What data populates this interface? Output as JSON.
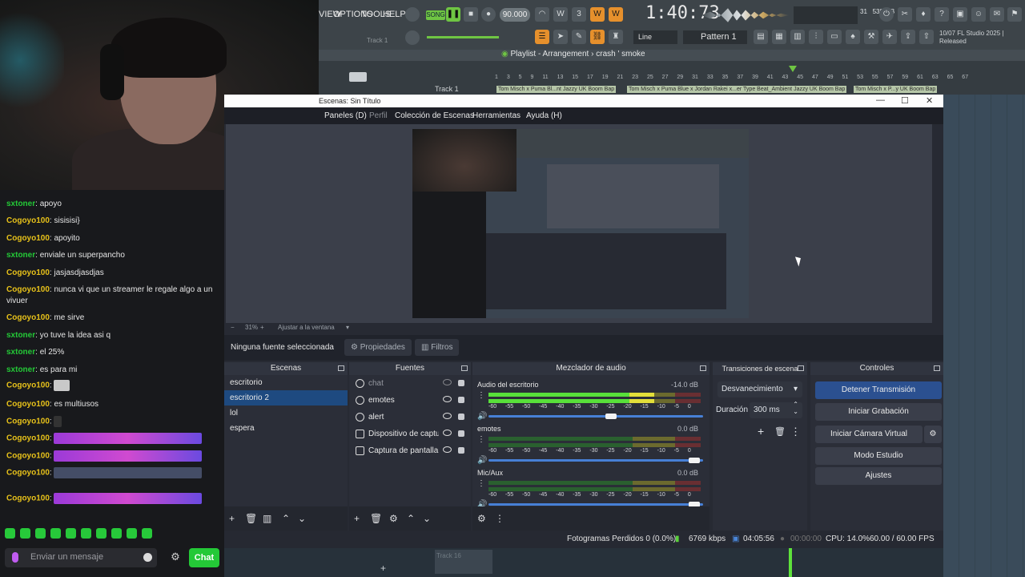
{
  "webcam": {
    "label": "streamer webcam"
  },
  "chat": {
    "messages": [
      {
        "user": "sxtoner",
        "text": "apoyo",
        "color": "#24c937"
      },
      {
        "user": "Cogoyo100",
        "text": "sisisisi}",
        "color": "#e8c21a"
      },
      {
        "user": "Cogoyo100",
        "text": "apoyito",
        "color": "#e8c21a"
      },
      {
        "user": "sxtoner",
        "text": "enviale un superpancho",
        "color": "#24c937"
      },
      {
        "user": "Cogoyo100",
        "text": "jasjasdjasdjas",
        "color": "#e8c21a"
      },
      {
        "user": "Cogoyo100",
        "text": "nunca vi que un streamer le regale algo a un vivuer",
        "color": "#e8c21a"
      },
      {
        "user": "Cogoyo100",
        "text": "me sirve",
        "color": "#e8c21a"
      },
      {
        "user": "sxtoner",
        "text": "yo tuve la idea asi q",
        "color": "#24c937"
      },
      {
        "user": "sxtoner",
        "text": "el 25%",
        "color": "#24c937"
      },
      {
        "user": "sxtoner",
        "text": "es para mi",
        "color": "#24c937"
      },
      {
        "user": "Cogoyo100",
        "text": "",
        "color": "#e8c21a"
      },
      {
        "user": "Cogoyo100",
        "text": "es multiusos",
        "color": "#e8c21a"
      },
      {
        "user": "Cogoyo100",
        "text": "",
        "color": "#e8c21a"
      },
      {
        "user": "Cogoyo100",
        "text": "",
        "color": "#e8c21a"
      },
      {
        "user": "Cogoyo100",
        "text": "",
        "color": "#e8c21a"
      },
      {
        "user": "Cogoyo100",
        "text": "",
        "color": "#e8c21a"
      },
      {
        "user": "Cogoyo100",
        "text": "",
        "color": "#e8c21a"
      }
    ],
    "input_placeholder": "Enviar un mensaje",
    "send_label": "Chat",
    "accent": "#24c937"
  },
  "fl": {
    "menu": [
      "VIEW",
      "OPTIONS",
      "TOOLS",
      "HELP"
    ],
    "mode": "SONG",
    "tempo": "90.000",
    "time": "1:40:73",
    "line_mode": "Line",
    "pattern": "Pattern 1",
    "track_label": "Track 1",
    "memory": "539 MB",
    "cpu_value": "31",
    "cpu_voices": "4",
    "news": "10/07  FL Studio 2025 | Released",
    "playlist_title": "Playlist - Arrangement",
    "playlist_sep": "›",
    "playlist_pattern": "crash ' smoke",
    "ruler": "1 3 5 9 11 13 15 17 19 21 23 25 27 29 31 33 35 37 39 41 43 45 47 49 51 53 55 57 59 61 63 65 67",
    "track_name": "Track 1",
    "clips": [
      "Tom Misch x Puma Bl...nt Jazzy UK Boom Bap",
      "Tom Misch x Puma Blue x Jordan Rakei x...er Type Beat_Ambient Jazzy UK Boom Bap",
      "Tom Misch x P...y UK Boom Bap"
    ],
    "bottom_track": "Track 16",
    "accent": "#e6902c"
  },
  "obs": {
    "title": "Escenas: Sin Título",
    "menu": [
      "Paneles (D)",
      "Perfil",
      "Colección de Escenas",
      "Herramientas",
      "Ayuda (H)"
    ],
    "zoom": "31%",
    "fit": "Ajustar a la ventana",
    "no_source": "Ninguna fuente seleccionada",
    "properties_label": "Propiedades",
    "filters_label": "Filtros",
    "scenes_title": "Escenas",
    "scenes": [
      "escritorio",
      "escritorio 2",
      "lol",
      "espera"
    ],
    "selected_scene": 1,
    "sources_title": "Fuentes",
    "sources": [
      {
        "name": "chat",
        "icon": "globe-icon",
        "visible": false
      },
      {
        "name": "emotes",
        "icon": "globe-icon",
        "visible": true
      },
      {
        "name": "alert",
        "icon": "globe-icon",
        "visible": true
      },
      {
        "name": "Dispositivo de captura de vídeo",
        "icon": "camera-icon",
        "visible": true
      },
      {
        "name": "Captura de pantalla",
        "icon": "monitor-icon",
        "visible": true
      }
    ],
    "mixer_title": "Mezclador de audio",
    "mixer": [
      {
        "name": "Audio del escritorio",
        "db": "-14.0 dB",
        "level": 0.78,
        "volume": 0.57
      },
      {
        "name": "emotes",
        "db": "0.0 dB",
        "level": 0,
        "volume": 0.96
      },
      {
        "name": "Mic/Aux",
        "db": "0.0 dB",
        "level": 0,
        "volume": 0.96
      }
    ],
    "meter_scale": "-60 -55 -50 -45 -40 -35 -30 -25 -20 -15 -10 -5 0",
    "transitions_title": "Transiciones de escena",
    "transition": "Desvanecimiento",
    "duration_label": "Duración",
    "duration": "300 ms",
    "controls_title": "Controles",
    "controls": [
      "Detener Transmisión",
      "Iniciar Grabación",
      "Iniciar Cámara Virtual",
      "Modo Estudio",
      "Ajustes"
    ],
    "status": {
      "dropped": "Fotogramas Perdidos 0 (0.0%)",
      "bitrate": "6769 kbps",
      "live_time": "04:05:56",
      "rec_time": "00:00:00",
      "cpu": "CPU: 14.0%",
      "fps": "60.00 / 60.00 FPS"
    },
    "accent": "#1e4a80"
  }
}
